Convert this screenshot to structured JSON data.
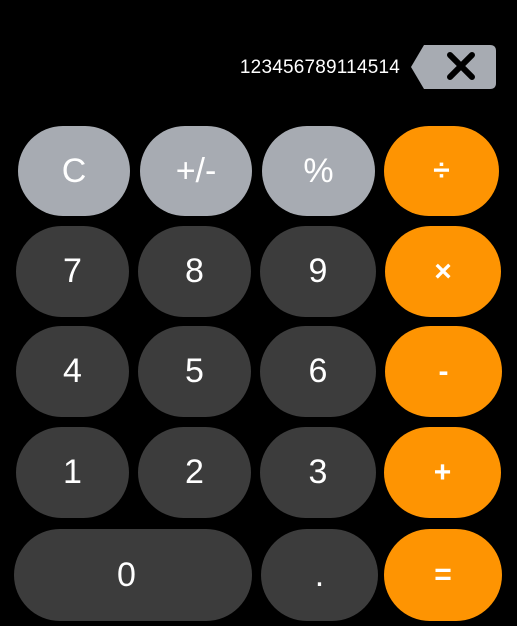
{
  "display": {
    "value": "123456789114514",
    "backspace_icon": "backspace-icon"
  },
  "keys": {
    "clear": "C",
    "negate": "+/-",
    "percent": "%",
    "divide": "÷",
    "seven": "7",
    "eight": "8",
    "nine": "9",
    "multiply": "×",
    "four": "4",
    "five": "5",
    "six": "6",
    "subtract": "-",
    "one": "1",
    "two": "2",
    "three": "3",
    "add": "+",
    "zero": "0",
    "decimal": ".",
    "equals": "="
  },
  "colors": {
    "background": "#000000",
    "function_key": "#a7abb2",
    "digit_key": "#3c3c3c",
    "operator_key": "#fe9402",
    "text": "#ffffff"
  }
}
